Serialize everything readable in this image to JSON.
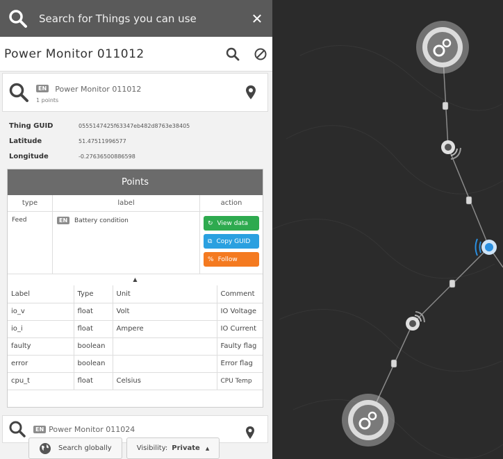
{
  "search": {
    "placeholder": "Search for Things you can use"
  },
  "header": {
    "title": "Power Monitor 011012"
  },
  "thing_card": {
    "lang": "EN",
    "name": "Power Monitor 011012",
    "points": "1 points"
  },
  "properties": [
    {
      "key": "Thing GUID",
      "value": "0555147425f63347eb482d8763e38405"
    },
    {
      "key": "Latitude",
      "value": "51.47511996577"
    },
    {
      "key": "Longitude",
      "value": "-0.27636500886598"
    }
  ],
  "points": {
    "title": "Points",
    "columns": {
      "type": "type",
      "label": "label",
      "action": "action"
    },
    "row": {
      "type": "Feed",
      "lang": "EN",
      "label": "Battery condition",
      "actions": {
        "view": "View data",
        "copy": "Copy GUID",
        "follow": "Follow"
      }
    },
    "caret": "▲",
    "values_table": {
      "headers": [
        "Label",
        "Type",
        "Unit",
        "Comment"
      ],
      "rows": [
        [
          "io_v",
          "float",
          "Volt",
          "IO Voltage"
        ],
        [
          "io_i",
          "float",
          "Ampere",
          "IO Current"
        ],
        [
          "faulty",
          "boolean",
          "",
          "Faulty flag"
        ],
        [
          "error",
          "boolean",
          "",
          "Error flag"
        ],
        [
          "cpu_t",
          "float",
          "Celsius",
          "CPU Temp"
        ]
      ]
    }
  },
  "second_card": {
    "lang": "EN",
    "name": "Power Monitor 011024"
  },
  "bottom": {
    "search_globally": "Search globally",
    "visibility_label": "Visibility:",
    "visibility_value": "Private",
    "visibility_caret": "▲"
  },
  "colors": {
    "green": "#2eaa4f",
    "blue": "#2aa0e0",
    "orange": "#f47a20",
    "graph_bg": "#2b2b2b",
    "node_highlight": "#2a8fe0"
  },
  "icons": [
    "search-icon",
    "close-icon",
    "block-icon",
    "map-pin-icon",
    "globe-icon",
    "gear-icon",
    "refresh-icon",
    "copy-icon",
    "link-icon"
  ]
}
